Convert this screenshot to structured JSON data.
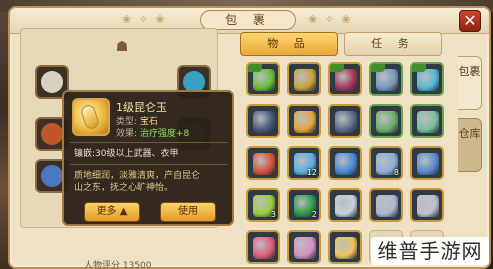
{
  "window": {
    "title": "包 裹"
  },
  "tabs": {
    "items_label": "物 品",
    "tasks_label": "任 务"
  },
  "side_tabs": {
    "bag": "包裹",
    "warehouse": "仓库"
  },
  "tooltip": {
    "item_name": "1级昆仑玉",
    "type_label": "类型:",
    "type_value": "宝石",
    "effect_label": "效果:",
    "effect_value": "治疗强度+8",
    "inlay_text": "镶嵌:30级以上武器、衣甲",
    "desc_line1": "质地细润，淡雅清爽，产自昆仑",
    "desc_line2": "山之东，抚之心旷神怡。",
    "more_button": "更多 ▲",
    "use_button": "使用"
  },
  "inventory": {
    "rows": [
      [
        {
          "icon": "jade-pendant-icon",
          "c": "#6cbf3a",
          "b": "gold",
          "badge": true
        },
        {
          "icon": "gourd-icon",
          "c": "#c9a23a",
          "b": "gold",
          "badge": false
        },
        {
          "icon": "armor-icon",
          "c": "#a63a5a",
          "b": "gold",
          "badge": true
        },
        {
          "icon": "armor-icon",
          "c": "#7a9abf",
          "b": "green",
          "badge": true
        },
        {
          "icon": "ring-icon",
          "c": "#56b8d8",
          "b": "green",
          "badge": true
        }
      ],
      [
        {
          "icon": "boots-icon",
          "c": "#4a5a7a",
          "b": "gold",
          "badge": false
        },
        {
          "icon": "gem-icon",
          "c": "#e3a63a",
          "b": "gold",
          "badge": false
        },
        {
          "icon": "boots-icon",
          "c": "#5a6a8a",
          "b": "gold",
          "badge": false
        },
        {
          "icon": "scroll-icon",
          "c": "#6fae6a",
          "b": "green",
          "badge": false
        },
        {
          "icon": "scroll-icon",
          "c": "#7ac0a0",
          "b": "green",
          "badge": false
        }
      ],
      [
        {
          "icon": "fire-orb-icon",
          "c": "#d8523a",
          "b": "gold",
          "badge": false
        },
        {
          "icon": "crystal-icon",
          "c": "#58b0e0",
          "b": "gold",
          "badge": false,
          "cnt": "12"
        },
        {
          "icon": "crystal-icon",
          "c": "#4a8ad8",
          "b": "gold",
          "badge": false
        },
        {
          "icon": "crystal-icon",
          "c": "#8ab0d8",
          "b": "gold",
          "badge": false,
          "cnt": "8"
        },
        {
          "icon": "moon-blade-icon",
          "c": "#5a8ad0",
          "b": "gold",
          "badge": false
        }
      ],
      [
        {
          "icon": "pearls-icon",
          "c": "#9acd3a",
          "b": "gold",
          "badge": false,
          "cnt": "3"
        },
        {
          "icon": "orb-icon",
          "c": "#2f9a4a",
          "b": "gold",
          "badge": false,
          "cnt": "2"
        },
        {
          "icon": "diamond-icon",
          "c": "#c8d0e0",
          "b": "gold",
          "badge": false
        },
        {
          "icon": "diamond-icon",
          "c": "#b0b8d0",
          "b": "gold",
          "badge": false
        },
        {
          "icon": "diamond-icon",
          "c": "#c0c0d0",
          "b": "gold",
          "badge": false
        }
      ],
      [
        {
          "icon": "red-orb-icon",
          "c": "#e0607a",
          "b": "gold",
          "badge": false
        },
        {
          "icon": "pink-orb-icon",
          "c": "#d890c0",
          "b": "gold",
          "badge": false
        },
        {
          "icon": "kunlun-jade-icon",
          "c": "#f0c558",
          "b": "gold",
          "badge": false
        },
        {
          "icon": "empty",
          "c": "",
          "b": "empty",
          "badge": false
        },
        {
          "icon": "empty",
          "c": "",
          "b": "empty",
          "badge": false
        }
      ]
    ]
  },
  "status": {
    "power_text": "人物评分   13500"
  },
  "watermark": {
    "text": "维普手游网"
  }
}
